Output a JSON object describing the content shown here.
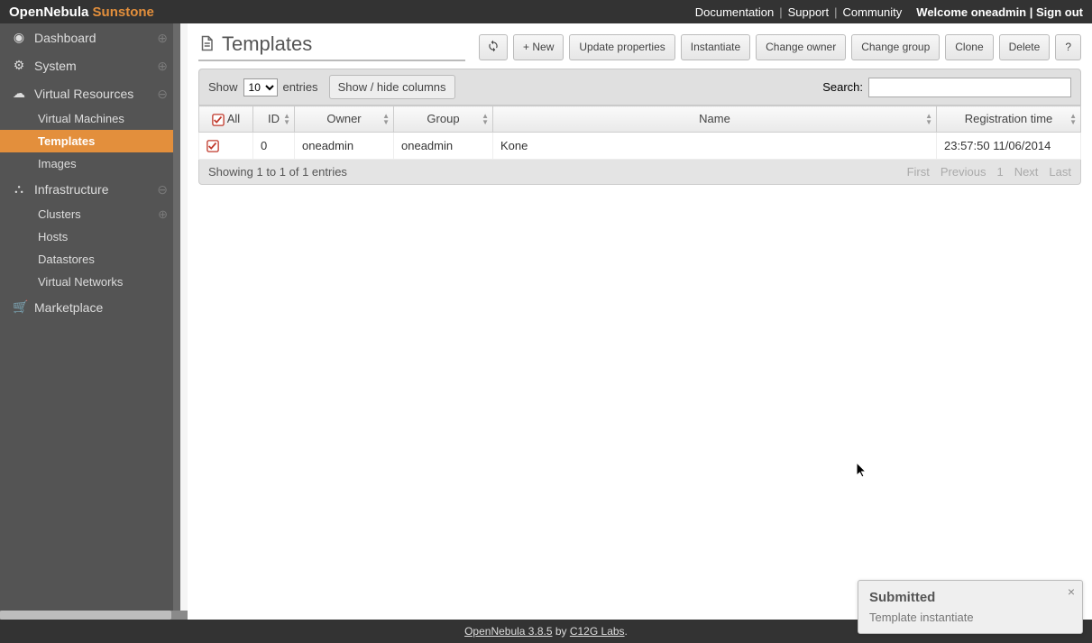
{
  "brand": {
    "prefix": "OpenNebula",
    "suffix": "Sunstone"
  },
  "top_links": {
    "documentation": "Documentation",
    "support": "Support",
    "community": "Community"
  },
  "welcome": {
    "text": "Welcome oneadmin",
    "signout": "Sign out"
  },
  "sidebar": {
    "dashboard": "Dashboard",
    "system": "System",
    "virtual_resources": "Virtual Resources",
    "vr_children": {
      "vms": "Virtual Machines",
      "templates": "Templates",
      "images": "Images"
    },
    "infrastructure": "Infrastructure",
    "infra_children": {
      "clusters": "Clusters",
      "hosts": "Hosts",
      "datastores": "Datastores",
      "vnets": "Virtual Networks"
    },
    "marketplace": "Marketplace"
  },
  "page": {
    "title": "Templates"
  },
  "toolbar": {
    "refresh_icon": "refresh",
    "new": "+ New",
    "update": "Update properties",
    "instantiate": "Instantiate",
    "chown": "Change owner",
    "chgrp": "Change group",
    "clone": "Clone",
    "delete": "Delete",
    "help": "?"
  },
  "controls": {
    "show_label": "Show",
    "entries_label": "entries",
    "page_size_value": "10",
    "showhide": "Show / hide columns",
    "search_label": "Search:"
  },
  "columns": {
    "all": "All",
    "id": "ID",
    "owner": "Owner",
    "group": "Group",
    "name": "Name",
    "regtime": "Registration time"
  },
  "rows": [
    {
      "id": "0",
      "owner": "oneadmin",
      "group": "oneadmin",
      "name": "Kone",
      "regtime": "23:57:50 11/06/2014"
    }
  ],
  "table_footer": {
    "info": "Showing 1 to 1 of 1 entries",
    "pager": {
      "first": "First",
      "previous": "Previous",
      "page": "1",
      "next": "Next",
      "last": "Last"
    }
  },
  "footer": {
    "product": "OpenNebula 3.8.5",
    "by": " by ",
    "vendor": "C12G Labs",
    "period": "."
  },
  "toast": {
    "title": "Submitted",
    "body": "Template instantiate",
    "close": "×"
  }
}
